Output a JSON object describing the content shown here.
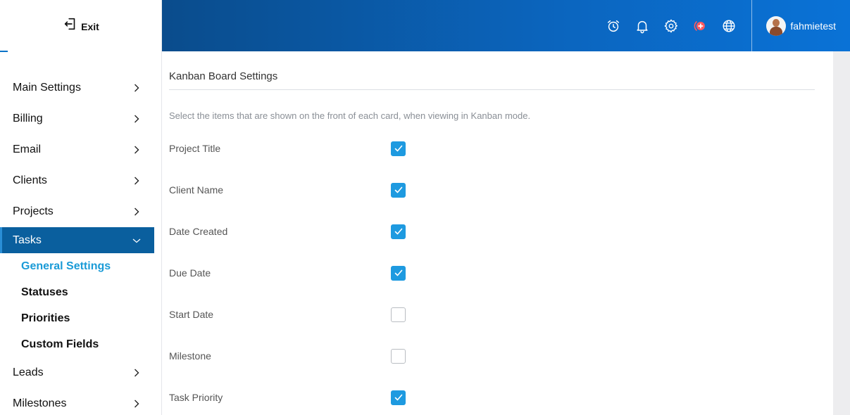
{
  "sidebar": {
    "exit_label": "Exit",
    "menu": [
      {
        "label": "Main Settings"
      },
      {
        "label": "Billing"
      },
      {
        "label": "Email"
      },
      {
        "label": "Clients"
      },
      {
        "label": "Projects"
      },
      {
        "label": "Tasks",
        "expanded": true
      }
    ],
    "tasks_submenu": [
      {
        "label": "General Settings",
        "current": true
      },
      {
        "label": "Statuses"
      },
      {
        "label": "Priorities"
      },
      {
        "label": "Custom Fields"
      }
    ],
    "menu_after": [
      {
        "label": "Leads"
      },
      {
        "label": "Milestones"
      }
    ]
  },
  "header": {
    "icons": [
      "alarm-clock-icon",
      "bell-icon",
      "gear-icon",
      "add-circle-icon",
      "globe-icon"
    ],
    "username": "fahmietest",
    "accent_color": "#0b66c0",
    "add_icon_color": "#ff5a5f"
  },
  "main": {
    "section_title": "Kanban Board Settings",
    "description": "Select the items that are shown on the front of each card, when viewing in Kanban mode.",
    "options": [
      {
        "label": "Project Title",
        "checked": true
      },
      {
        "label": "Client Name",
        "checked": true
      },
      {
        "label": "Date Created",
        "checked": true
      },
      {
        "label": "Due Date",
        "checked": true
      },
      {
        "label": "Start Date",
        "checked": false
      },
      {
        "label": "Milestone",
        "checked": false
      },
      {
        "label": "Task Priority",
        "checked": true
      }
    ],
    "checkbox_color": "#1e9ae0"
  }
}
